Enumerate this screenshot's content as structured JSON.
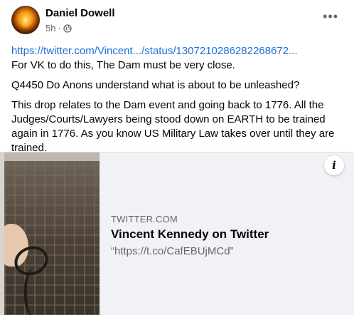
{
  "post": {
    "author": "Daniel Dowell",
    "time": "5h",
    "dot": "·",
    "more_icon": "more-horizontal-icon",
    "audience_icon": "globe-icon"
  },
  "content": {
    "link": "https://twitter.com/Vincent.../status/1307210286282268672...",
    "line1": "For VK to do this, The Dam must be very close.",
    "line2": "Q4450 Do Anons understand what is about to be unleashed?",
    "line3": "This drop relates to the Dam event and going back to 1776. All the Judges/Courts/Lawyers being stood down on EARTH to be trained again in 1776. As you know US Military Law takes over until they are trained."
  },
  "preview": {
    "domain": "TWITTER.COM",
    "title": "Vincent Kennedy on Twitter",
    "description": "“https://t.co/CafEBUjMCd”",
    "info_label": "i"
  }
}
